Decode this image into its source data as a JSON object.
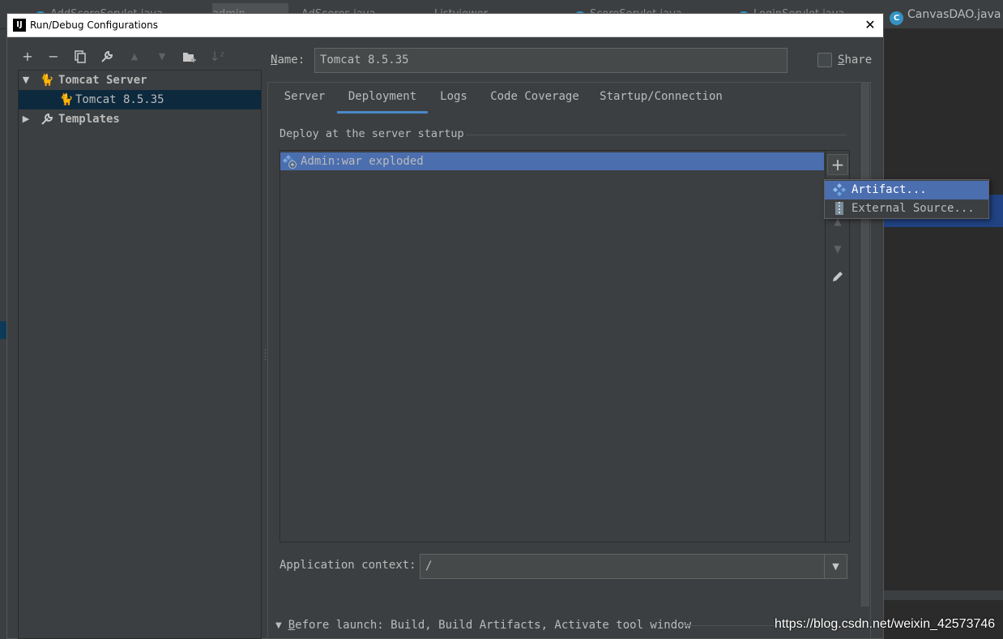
{
  "background": {
    "tabs": [
      "AddScoreServlet.java",
      "admin",
      "AdScores.java",
      "Listviewer",
      "ScoreServlet.java",
      "LoginServlet.java"
    ],
    "right_tab": "CanvasDAO.java"
  },
  "dialog": {
    "title": "Run/Debug Configurations",
    "close_glyph": "✕"
  },
  "toolbar": {
    "icons": [
      "add-icon",
      "remove-icon",
      "copy-icon",
      "wrench-icon",
      "move-up-icon",
      "move-down-icon",
      "new-folder-icon",
      "sort-icon"
    ]
  },
  "tree": {
    "group_label": "Tomcat Server",
    "config_label": "Tomcat 8.5.35",
    "templates_label": "Templates"
  },
  "name_field": {
    "label_mnemonic": "N",
    "label_rest": "ame:",
    "value": "Tomcat 8.5.35"
  },
  "share": {
    "label_mnemonic": "S",
    "label_rest": "hare",
    "checked": false
  },
  "tabs": [
    "Server",
    "Deployment",
    "Logs",
    "Code Coverage",
    "Startup/Connection"
  ],
  "active_tab": "Deployment",
  "deploy": {
    "section_title": "Deploy at the server startup",
    "items": [
      "Admin:war exploded"
    ],
    "add_glyph": "+"
  },
  "popup": {
    "items": [
      "Artifact...",
      "External Source..."
    ]
  },
  "app_context": {
    "label": "Application context:",
    "value": "/"
  },
  "before_launch": {
    "mnemonic": "B",
    "rest": "efore launch: Build, Build Artifacts, Activate tool window"
  },
  "watermark": "https://blog.csdn.net/weixin_42573746",
  "colors": {
    "background": "#3c3f41",
    "selection": "#4b6eaf",
    "tree_selection": "#0d293e",
    "tab_underline": "#4a88c7",
    "tomcat_icon": "#e8c21e"
  }
}
